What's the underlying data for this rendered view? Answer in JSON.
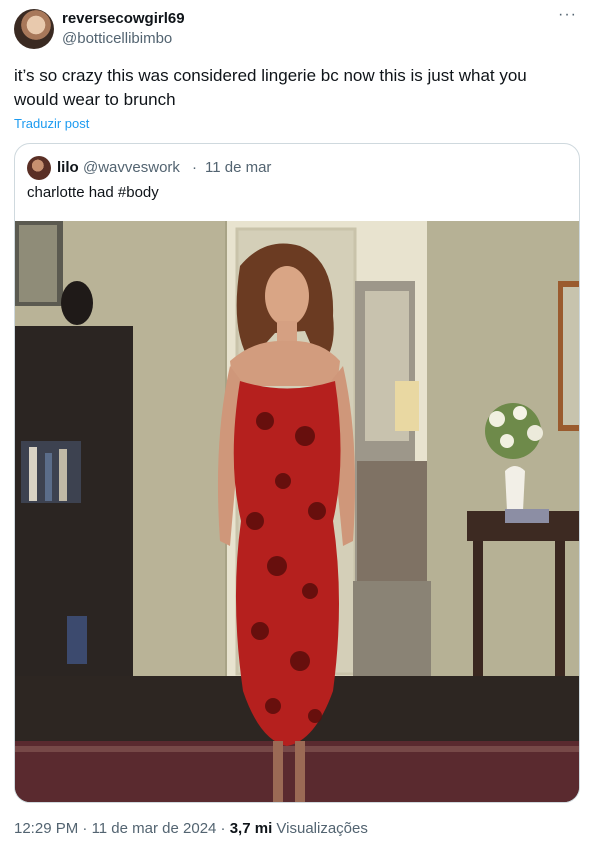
{
  "author": {
    "display_name": "reversecowgirl69",
    "handle": "@botticellibimbo"
  },
  "more_label": "···",
  "tweet": {
    "text": "it’s so crazy this was considered lingerie bc now this is just what you would wear to brunch",
    "translate_label": "Traduzir post"
  },
  "quote": {
    "display_name": "lilo",
    "handle": "@wavveswork",
    "separator": "·",
    "date": "11 de mar",
    "text": "charlotte had #body"
  },
  "meta": {
    "time": "12:29 PM",
    "sep1": "·",
    "date": "11 de mar de 2024",
    "sep2": "·",
    "views_count": "3,7 mi",
    "views_label": "Visualizações"
  },
  "colors": {
    "link": "#1d9bf0",
    "muted": "#536471",
    "text": "#0f1419",
    "border": "#cfd9de",
    "dress": "#b5201e"
  }
}
